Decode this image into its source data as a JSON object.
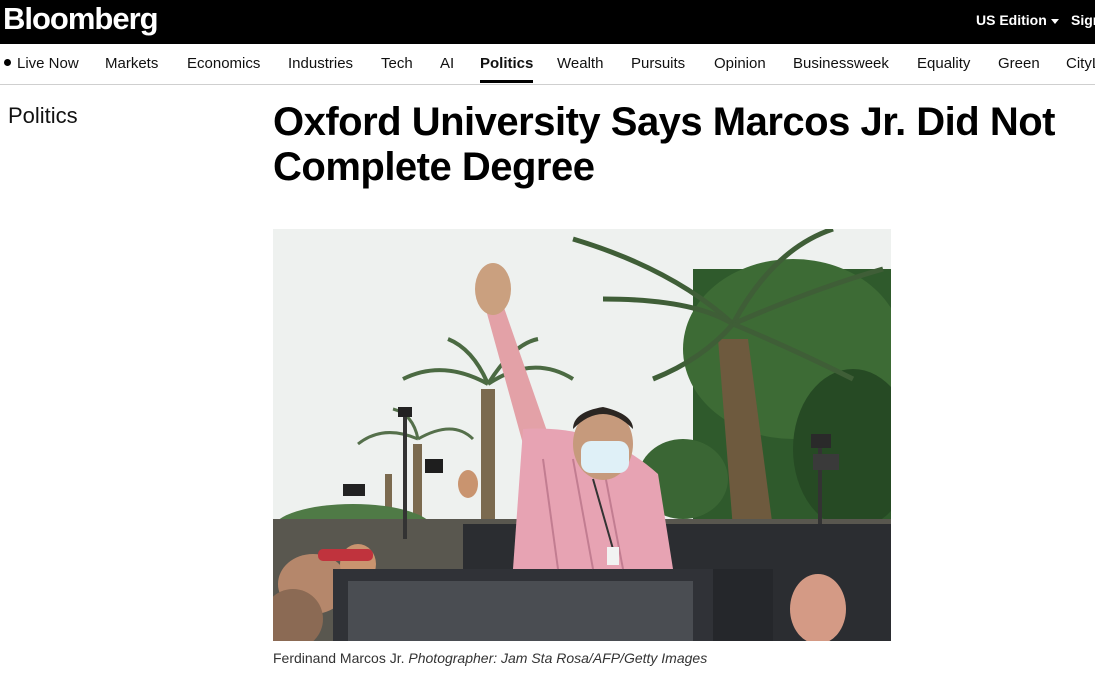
{
  "header": {
    "logo": "Bloomberg",
    "edition_label": "US Edition",
    "signin_label": "Sign"
  },
  "nav": {
    "items": [
      {
        "label": "Live Now"
      },
      {
        "label": "Markets"
      },
      {
        "label": "Economics"
      },
      {
        "label": "Industries"
      },
      {
        "label": "Tech"
      },
      {
        "label": "AI"
      },
      {
        "label": "Politics"
      },
      {
        "label": "Wealth"
      },
      {
        "label": "Pursuits"
      },
      {
        "label": "Opinion"
      },
      {
        "label": "Businessweek"
      },
      {
        "label": "Equality"
      },
      {
        "label": "Green"
      },
      {
        "label": "CityL"
      }
    ],
    "active": "Politics"
  },
  "article": {
    "section": "Politics",
    "headline": "Oxford University Says Marcos Jr. Did Not Complete Degree",
    "caption_subject": "Ferdinand Marcos Jr.",
    "caption_credit": "Photographer: Jam Sta Rosa/AFP/Getty Images"
  },
  "colors": {
    "topbar": "#000000",
    "active_underline": "#000000",
    "shirt": "#e7a3b3",
    "mask": "#dff0f7"
  }
}
